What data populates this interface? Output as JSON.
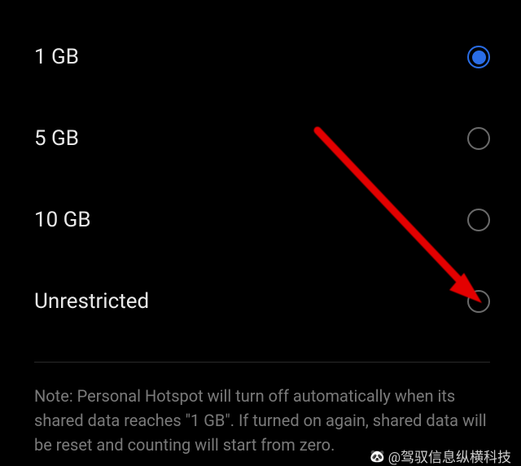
{
  "options": [
    {
      "label": "1 GB",
      "selected": true,
      "name": "option-1gb"
    },
    {
      "label": "5 GB",
      "selected": false,
      "name": "option-5gb"
    },
    {
      "label": "10 GB",
      "selected": false,
      "name": "option-10gb"
    },
    {
      "label": "Unrestricted",
      "selected": false,
      "name": "option-unrestricted"
    }
  ],
  "note": "Note: Personal Hotspot will turn off automatically when its shared data reaches \"1 GB\". If turned on again, shared data will be reset and counting will start from zero.",
  "attribution": "@驾驭信息纵横科技"
}
